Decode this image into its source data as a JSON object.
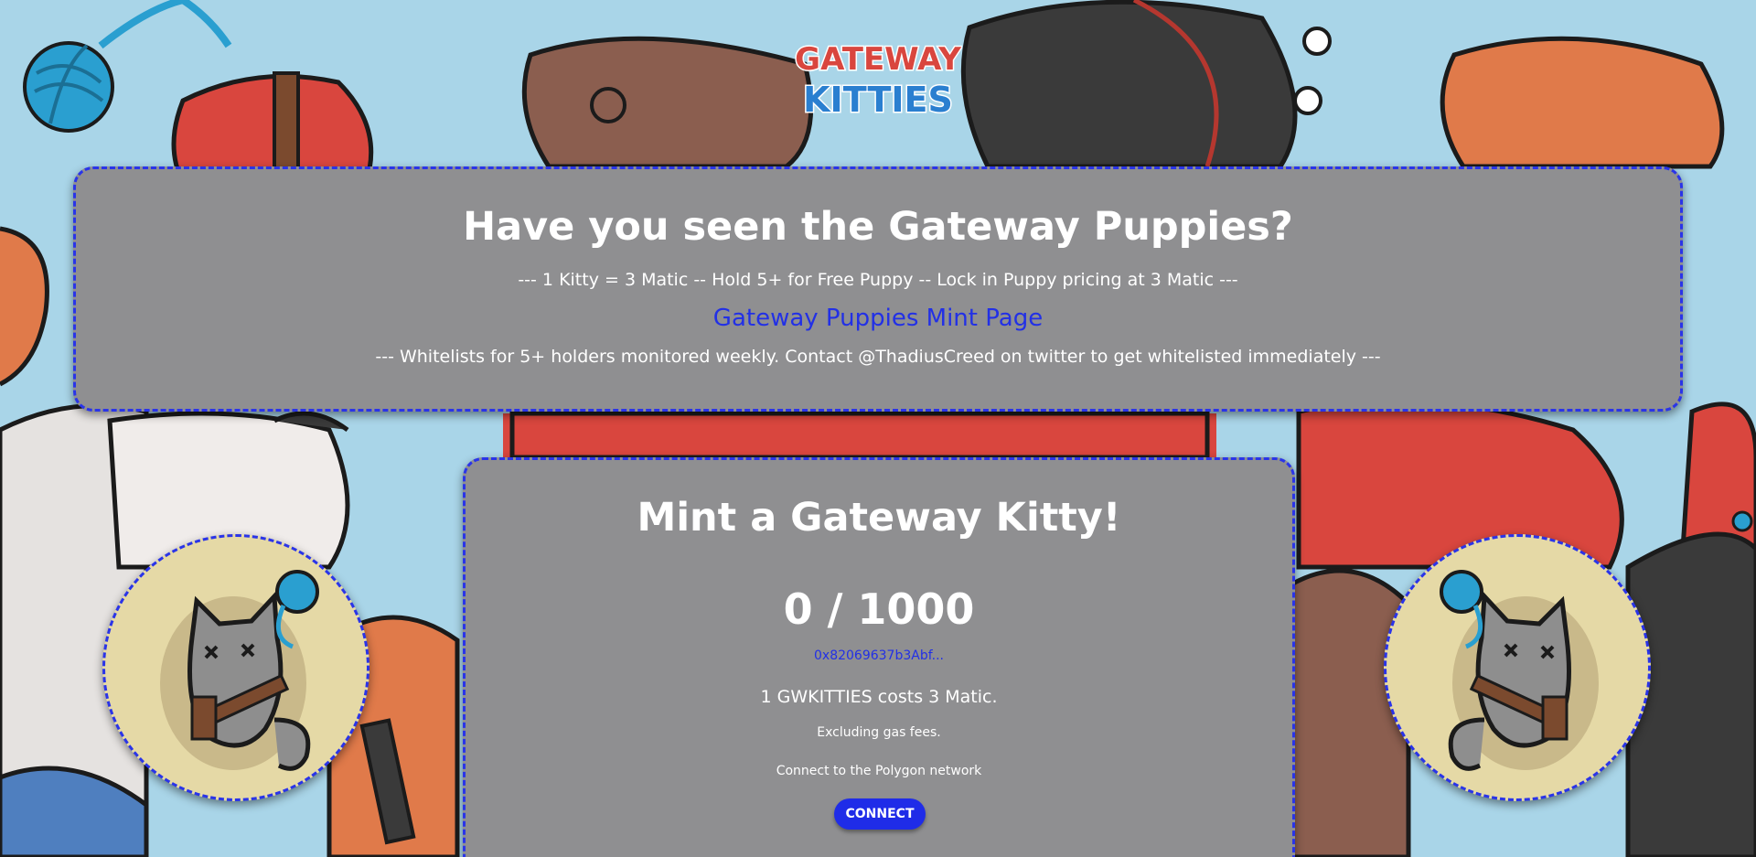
{
  "logo": {
    "line1": "GATEWAY",
    "line2": "KITTIES"
  },
  "puppies": {
    "title": "Have you seen the Gateway Puppies?",
    "pricing_line": "--- 1 Kitty = 3 Matic -- Hold 5+ for Free Puppy -- Lock in Puppy pricing at 3 Matic ---",
    "mint_link": "Gateway Puppies Mint Page",
    "whitelist_line": "--- Whitelists for 5+ holders monitored weekly. Contact @ThadiusCreed on twitter to get whitelisted immediately ---"
  },
  "mint": {
    "title": "Mint a Gateway Kitty!",
    "count": "0 / 1000",
    "contract_address": "0x82069637b3Abf...",
    "cost_text": "1 GWKITTIES costs 3 Matic.",
    "gas_note": "Excluding gas fees.",
    "network_note": "Connect to the Polygon network",
    "connect_label": "CONNECT"
  },
  "colors": {
    "background": "#a9d5e8",
    "panel": "#8f8f91",
    "accent": "#2a34e8",
    "button": "#1f2ce8",
    "avatar_bg": "#e5d9a6"
  }
}
